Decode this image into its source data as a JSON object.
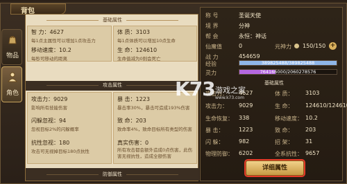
{
  "window": {
    "title": "背包",
    "close_icon": "close-icon"
  },
  "topbar": {
    "left": "20.101",
    "mid": "49.1 -10"
  },
  "side_tabs": [
    {
      "label": "物品",
      "icon": "bag-icon",
      "active": false
    },
    {
      "label": "角色",
      "icon": "character-icon",
      "active": true
    }
  ],
  "left": {
    "section_basic": "基础属性",
    "basic": [
      {
        "key": "智  力：",
        "value": "4627",
        "desc": "每1点主属性可以增加1点攻击力"
      },
      {
        "key": "体  质：",
        "value": "3103",
        "desc": "每1点体质可以增加10点生命"
      },
      {
        "key": "移动速度：",
        "value": "10.2",
        "desc": "每秒可移动的距离"
      },
      {
        "key": "生  命：",
        "value": "124610",
        "desc": "生命值减为0则会死亡"
      }
    ],
    "section_attack": "攻击属性",
    "attack": [
      {
        "key": "攻击力：",
        "value": "9029",
        "desc": "影响所有技能伤害"
      },
      {
        "key": "暴  击：",
        "value": "1223",
        "desc": "暴击率30%，暴击可造成193%伤害"
      },
      {
        "key": "闪躲忽视：",
        "value": "94",
        "desc": "忽视目标2%的闪躲概率"
      },
      {
        "key": "致  命：",
        "value": "203",
        "desc": "致命率4%，致命目标所有类型的伤害"
      },
      {
        "key": "抗性忽视：",
        "value": "180",
        "desc": "攻击可无视掉目标180点抗性"
      },
      {
        "key": "真实伤害：",
        "value": "0",
        "desc": "所有攻击都会额外造成0点伤害，此伤害无视抗性，造成全额伤害"
      }
    ],
    "section_defense": "防御属性"
  },
  "right": {
    "info": [
      {
        "key": "称  号",
        "value": "圣诞天使"
      },
      {
        "key": "境  界",
        "value": "分神"
      },
      {
        "key": "帮  会",
        "value": "永恒：神话"
      },
      {
        "key": "仙魔值",
        "value": "0",
        "extra_key": "元神力",
        "extra_value": "150/150"
      },
      {
        "key": "战  力",
        "value": "454659"
      }
    ],
    "exp": {
      "label": "经验",
      "text": "389825488/389825488",
      "ratio": 1.0
    },
    "soul": {
      "label": "灵力",
      "text": "764166000/2060278576",
      "ratio": 0.37
    },
    "section_basic": "基础属性",
    "stats": [
      {
        "k1": "攻击力：",
        "v1": "4627",
        "k2": "体  质：",
        "v2": "3103"
      },
      {
        "k1": "攻击力：",
        "v1": "9029",
        "k2": "生  命：",
        "v2": "124610/124610"
      },
      {
        "k1": "生命恢复：",
        "v1": "338",
        "k2": "移动速度：",
        "v2": "10.2"
      },
      {
        "k1": "暴  击：",
        "v1": "1223",
        "k2": "致  命：",
        "v2": "203"
      },
      {
        "k1": "闪  躲：",
        "v1": "982",
        "k2": "招  架：",
        "v2": "31"
      },
      {
        "k1": "物理防御：",
        "v1": "6202",
        "k2": "全系抗性：",
        "v2": "9657"
      }
    ],
    "detail_button": "详细属性"
  },
  "watermark": {
    "logo": "K73",
    "text": "游戏之家",
    "url": "www.k73.com"
  },
  "colors": {
    "exp_bar": "#8fb6e8",
    "soul_bar": "#b467e0",
    "accent_red": "#e53a28"
  }
}
